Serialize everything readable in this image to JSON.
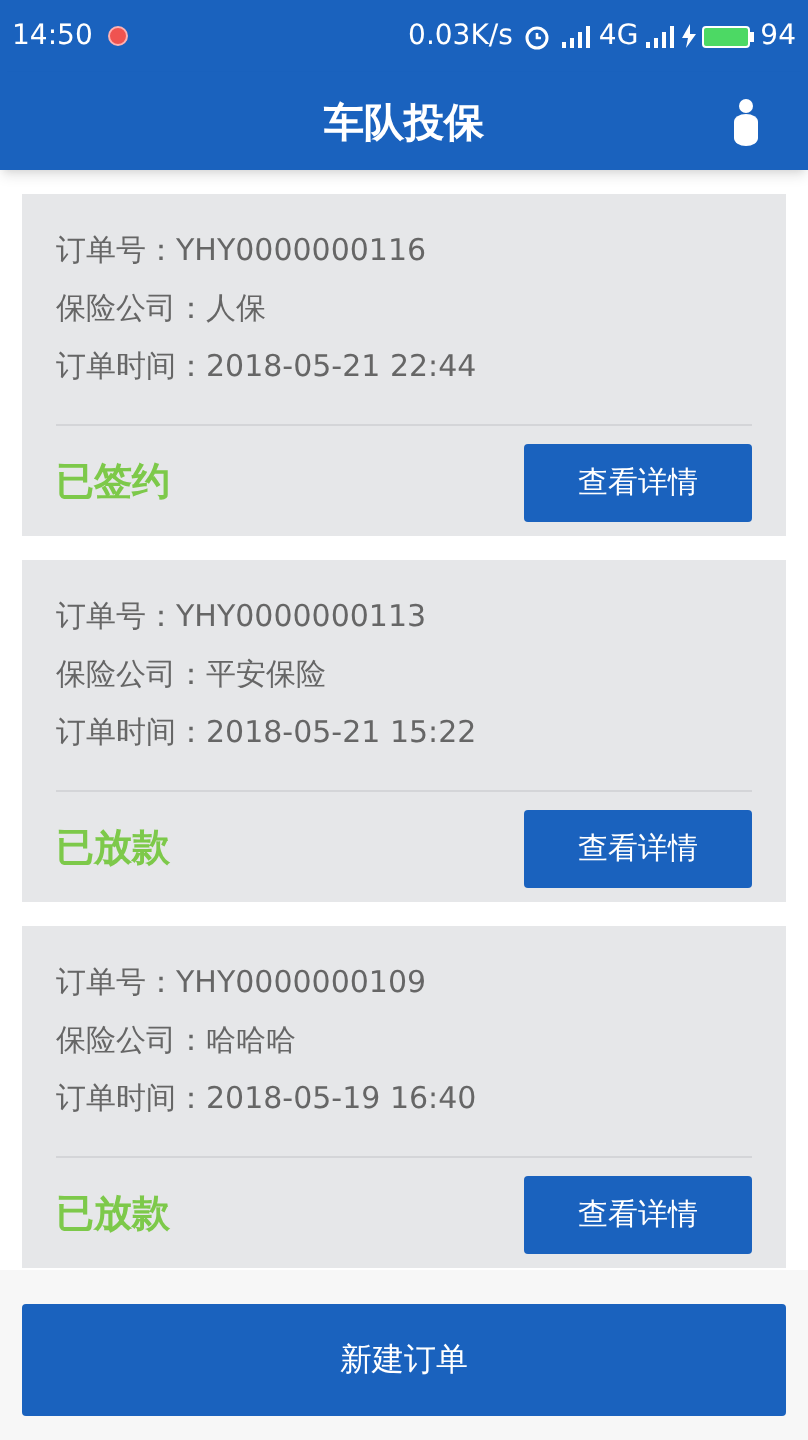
{
  "status_bar": {
    "time": "14:50",
    "speed": "0.03K/s",
    "network": "4G",
    "battery": "94"
  },
  "header": {
    "title": "车队投保"
  },
  "orders": [
    {
      "order_no": "订单号：YHY0000000116",
      "company": "保险公司：人保",
      "time": "订单时间：2018-05-21  22:44",
      "status": "已签约",
      "action": "查看详情"
    },
    {
      "order_no": "订单号：YHY0000000113",
      "company": "保险公司：平安保险",
      "time": "订单时间：2018-05-21  15:22",
      "status": "已放款",
      "action": "查看详情"
    },
    {
      "order_no": "订单号：YHY0000000109",
      "company": "保险公司：哈哈哈",
      "time": "订单时间：2018-05-19  16:40",
      "status": "已放款",
      "action": "查看详情"
    }
  ],
  "bottom_button": "新建订单"
}
